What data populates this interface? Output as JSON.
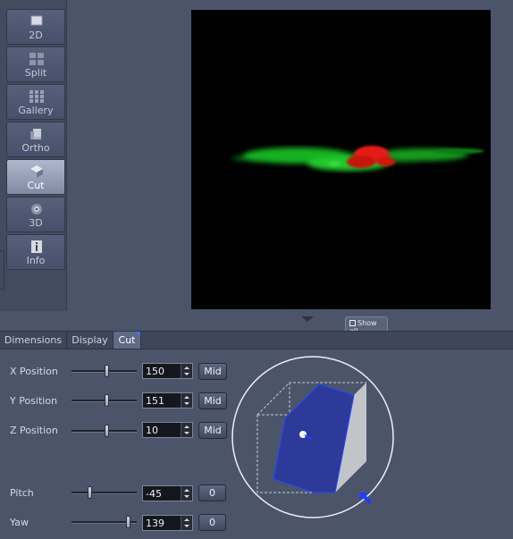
{
  "sidebar": {
    "items": [
      {
        "label": "2D",
        "icon": "single-view-icon"
      },
      {
        "label": "Split",
        "icon": "split-view-icon"
      },
      {
        "label": "Gallery",
        "icon": "gallery-grid-icon"
      },
      {
        "label": "Ortho",
        "icon": "ortho-view-icon"
      },
      {
        "label": "Cut",
        "icon": "cut-cube-icon",
        "active": true
      },
      {
        "label": "3D",
        "icon": "3d-view-icon"
      },
      {
        "label": "Info",
        "icon": "info-icon"
      }
    ]
  },
  "viewer": {
    "show_all_label": "Show all"
  },
  "tabs": [
    {
      "label": "Dimensions"
    },
    {
      "label": "Display"
    },
    {
      "label": "Cut",
      "active": true
    }
  ],
  "controls": {
    "x_position": {
      "label": "X Position",
      "value": "150",
      "button": "Mid"
    },
    "y_position": {
      "label": "Y Position",
      "value": "151",
      "button": "Mid"
    },
    "z_position": {
      "label": "Z Position",
      "value": "10",
      "button": "Mid"
    },
    "pitch": {
      "label": "Pitch",
      "value": "-45",
      "button": "0"
    },
    "yaw": {
      "label": "Yaw",
      "value": "139",
      "button": "0"
    }
  },
  "colors": {
    "accent": "#3a7bff",
    "panel": "#4b5469",
    "cut_plane": "#2d3a9a"
  }
}
